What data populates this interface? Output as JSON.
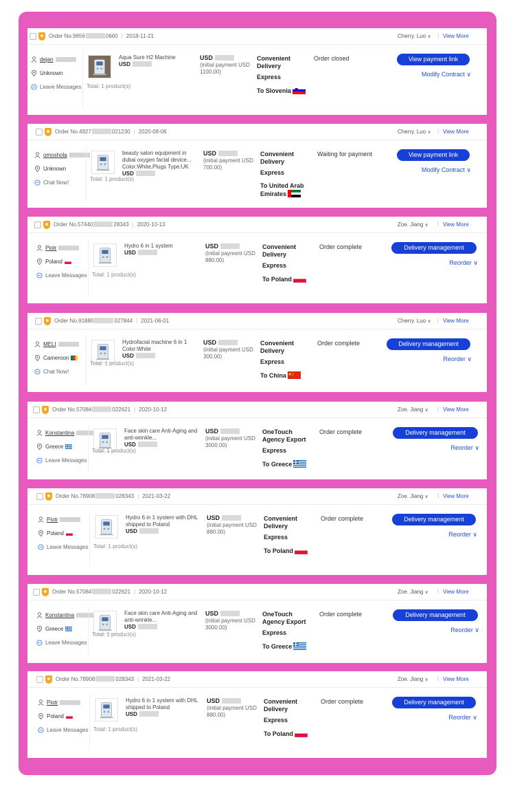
{
  "common": {
    "view_more": "View More",
    "leave_messages": "Leave Messages",
    "chat_now": "Chat Now!",
    "unknown": "Unknown",
    "total": "Total:  1 product(s)",
    "usd": "USD",
    "initial_prefix": "(initial payment USD"
  },
  "orders": [
    {
      "order_prefix": "Order No.9656",
      "order_suffix": "0660",
      "date": "2018-11-21",
      "agent": "Cherry. Luo",
      "buyer_name": "dejan",
      "buyer_location": "Unknown",
      "location_flag": "",
      "buyer_action": "Leave Messages",
      "product_title": "Aqua Sure H2 Machine",
      "product_sub": "",
      "initial_amount": "1100.00)",
      "ship_method": "Convenient Delivery",
      "ship_sub": "Express",
      "ship_dest": "To Slovenia",
      "status": "Order closed",
      "btn_label": "View payment link",
      "link_label": "Modify Contract"
    },
    {
      "order_prefix": "Order No.4927",
      "order_suffix": "021230",
      "date": "2020-08-06",
      "agent": "Cherry. Luo",
      "buyer_name": "omoshola",
      "buyer_location": "Unknown",
      "location_flag": "",
      "buyer_action": "Chat Now!",
      "product_title": "beauty salon equipment in dubai oxygen facial device...",
      "product_sub": "Color:White,Plugs Type:UK",
      "initial_amount": "700.00)",
      "ship_method": "Convenient Delivery",
      "ship_sub": "Express",
      "ship_dest": "To United Arab Emirates",
      "status": "Waiting for payment",
      "btn_label": "View payment link",
      "link_label": "Modify Contract"
    },
    {
      "order_prefix": "Order No.57440",
      "order_suffix": "28343",
      "date": "2020-10-13",
      "agent": "Zoe. Jiang",
      "buyer_name": "Piotr",
      "buyer_location": "Poland",
      "location_flag": "pl",
      "buyer_action": "Leave Messages",
      "product_title": "Hydro 6 in 1 system",
      "product_sub": "",
      "initial_amount": "880.00)",
      "ship_method": "Convenient Delivery",
      "ship_sub": "Express",
      "ship_dest": "To Poland",
      "status": "Order complete",
      "btn_label": "Delivery management",
      "link_label": "Reorder"
    },
    {
      "order_prefix": "Order No.91880",
      "order_suffix": "027844",
      "date": "2021-06-01",
      "agent": "Cherry. Luo",
      "buyer_name": "MELI",
      "buyer_location": "Cameroon",
      "location_flag": "cm",
      "buyer_action": "Chat Now!",
      "product_title": "Hydrofacial machine 6 in 1",
      "product_sub": "Color:White",
      "initial_amount": "300.00)",
      "ship_method": "Convenient Delivery",
      "ship_sub": "Express",
      "ship_dest": "To China",
      "status": "Order complete",
      "btn_label": "Delivery management",
      "link_label": "Reorder"
    },
    {
      "order_prefix": "Order No.57084",
      "order_suffix": "022621",
      "date": "2020-10-12",
      "agent": "Zoe. Jiang",
      "buyer_name": "Konstantina",
      "buyer_location": "Greece",
      "location_flag": "gr",
      "buyer_action": "Leave Messages",
      "product_title": "Face skin care Anti-Aging and anti-wrinkle...",
      "product_sub": "",
      "initial_amount": "3000.00)",
      "ship_method": "OneTouch Agency Export",
      "ship_sub": "Express",
      "ship_dest": "To Greece",
      "status": "Order complete",
      "btn_label": "Delivery management",
      "link_label": "Reorder"
    },
    {
      "order_prefix": "Order No.78908",
      "order_suffix": "028343",
      "date": "2021-03-22",
      "agent": "Zoe. Jiang",
      "buyer_name": "Piotr",
      "buyer_location": "Poland",
      "location_flag": "pl",
      "buyer_action": "Leave Messages",
      "product_title": "Hydro 6 in 1 system with DHL shipped to Poland",
      "product_sub": "",
      "initial_amount": "880.00)",
      "ship_method": "Convenient Delivery",
      "ship_sub": "Express",
      "ship_dest": "To Poland",
      "status": "Order complete",
      "btn_label": "Delivery management",
      "link_label": "Reorder"
    },
    {
      "order_prefix": "Order No.57084",
      "order_suffix": "022621",
      "date": "2020-10-12",
      "agent": "Zoe. Jiang",
      "buyer_name": "Konstantina",
      "buyer_location": "Greece",
      "location_flag": "gr",
      "buyer_action": "Leave Messages",
      "product_title": "Face skin care Anti-Aging and anti-wrinkle...",
      "product_sub": "",
      "initial_amount": "3000.00)",
      "ship_method": "OneTouch Agency Export",
      "ship_sub": "Express",
      "ship_dest": "To Greece",
      "status": "Order complete",
      "btn_label": "Delivery management",
      "link_label": "Reorder"
    },
    {
      "order_prefix": "Order No.78908",
      "order_suffix": "028343",
      "date": "2021-03-22",
      "agent": "Zoe. Jiang",
      "buyer_name": "Piotr",
      "buyer_location": "Poland",
      "location_flag": "pl",
      "buyer_action": "Leave Messages",
      "product_title": "Hydro 6 in 1 system with DHL shipped to Poland",
      "product_sub": "",
      "initial_amount": "880.00)",
      "ship_method": "Convenient Delivery",
      "ship_sub": "Express",
      "ship_dest": "To Poland",
      "status": "Order complete",
      "btn_label": "Delivery management",
      "link_label": "Reorder"
    }
  ],
  "colors": {
    "frame": "#e65bbd",
    "button": "#1640d8",
    "link": "#1e4fd8",
    "badge": "#f5a623"
  }
}
